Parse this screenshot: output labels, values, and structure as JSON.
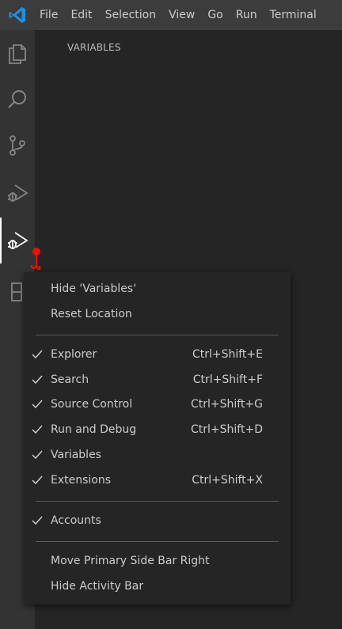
{
  "menubar": {
    "items": [
      "File",
      "Edit",
      "Selection",
      "View",
      "Go",
      "Run",
      "Terminal"
    ]
  },
  "activity_bar": {
    "icons": [
      "explorer-icon",
      "search-icon",
      "source-control-icon",
      "run-and-debug-icon",
      "variables-view-icon",
      "extensions-icon"
    ],
    "active": "variables-view-icon"
  },
  "sidebar": {
    "title": "VARIABLES"
  },
  "context_menu": {
    "top_items": [
      {
        "label": "Hide 'Variables'"
      },
      {
        "label": "Reset Location"
      }
    ],
    "view_items": [
      {
        "label": "Explorer",
        "shortcut": "Ctrl+Shift+E",
        "checked": true
      },
      {
        "label": "Search",
        "shortcut": "Ctrl+Shift+F",
        "checked": true
      },
      {
        "label": "Source Control",
        "shortcut": "Ctrl+Shift+G",
        "checked": true
      },
      {
        "label": "Run and Debug",
        "shortcut": "Ctrl+Shift+D",
        "checked": true
      },
      {
        "label": "Variables",
        "shortcut": "",
        "checked": true
      },
      {
        "label": "Extensions",
        "shortcut": "Ctrl+Shift+X",
        "checked": true
      }
    ],
    "account_items": [
      {
        "label": "Accounts",
        "checked": true
      }
    ],
    "bottom_items": [
      {
        "label": "Move Primary Side Bar Right"
      },
      {
        "label": "Hide Activity Bar"
      }
    ]
  },
  "colors": {
    "accent": "#0078d4",
    "cursor_mark": "#e51400"
  }
}
